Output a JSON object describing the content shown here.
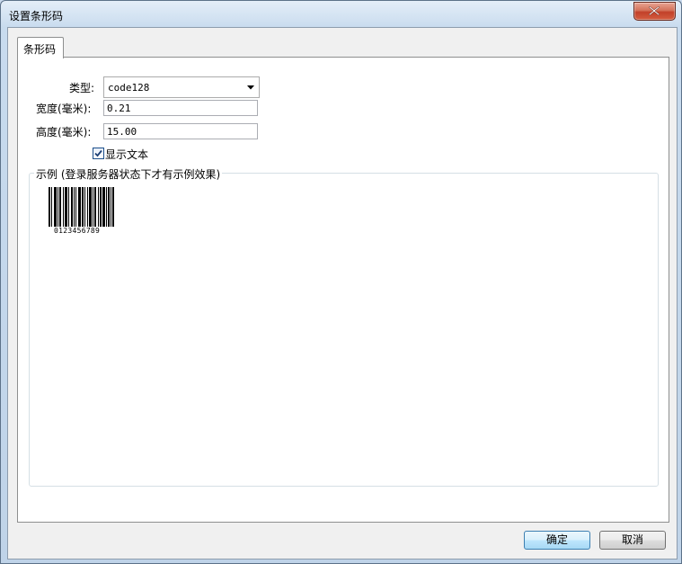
{
  "window": {
    "title": "设置条形码"
  },
  "tab": {
    "label": "条形码"
  },
  "form": {
    "type_label": "类型:",
    "type_value": "code128",
    "width_label": "宽度(毫米):",
    "width_value": "0.21",
    "height_label": "高度(毫米):",
    "height_value": "15.00",
    "show_text_label": "显示文本",
    "show_text_checked": true
  },
  "preview": {
    "title": "示例 (登录服务器状态下才有示例效果)",
    "barcode_text": "0123456789"
  },
  "buttons": {
    "ok": "确定",
    "cancel": "取消"
  },
  "icons": {
    "close": "close-icon",
    "dropdown": "chevron-down-icon",
    "check": "check-icon"
  },
  "colors": {
    "close_button": "#c2412a",
    "default_button_border": "#3c7fb1"
  }
}
